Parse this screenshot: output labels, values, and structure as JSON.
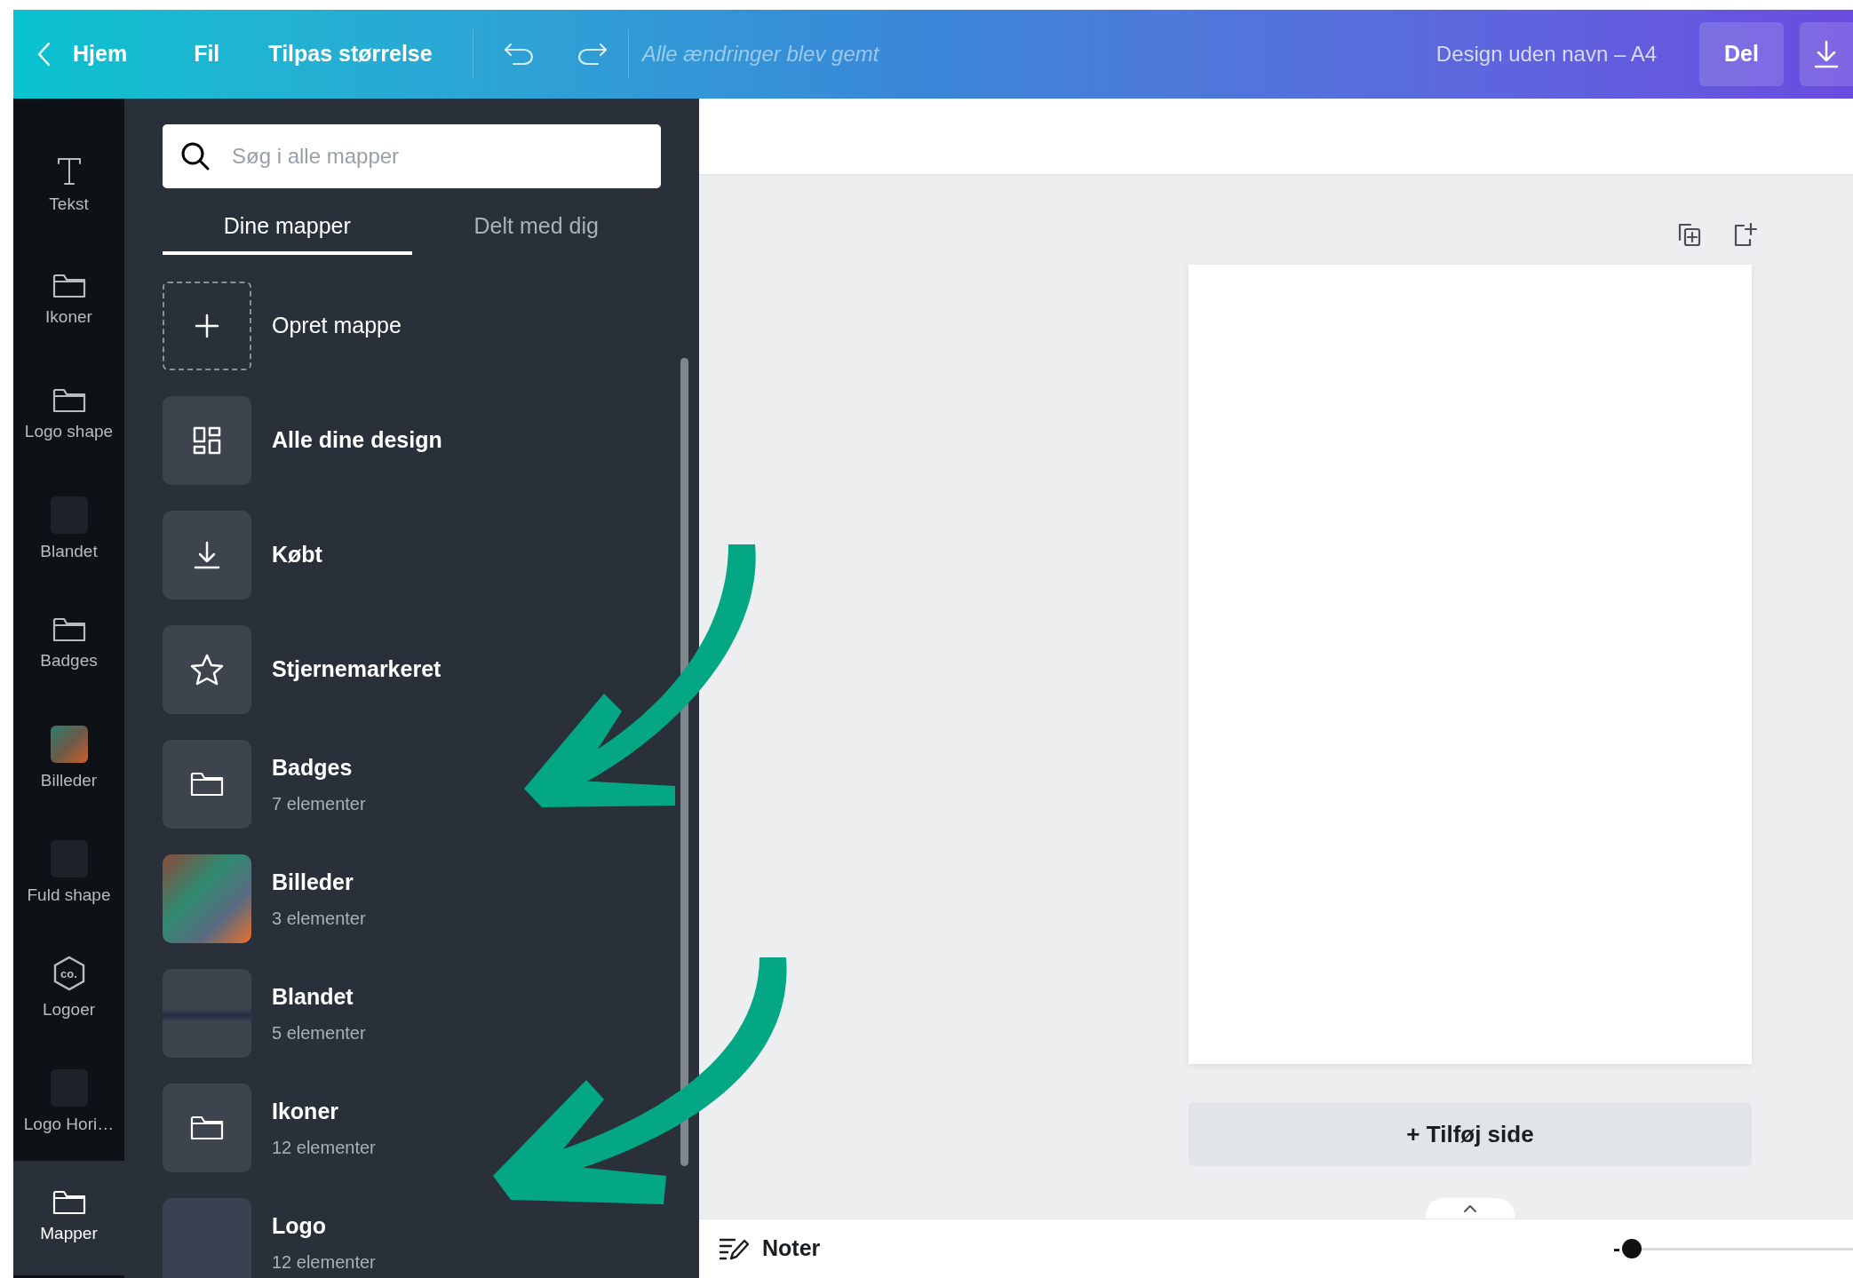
{
  "top_bar": {
    "back_label": "Hjem",
    "menu": [
      "Fil",
      "Tilpas størrelse"
    ],
    "save_status": "Alle ændringer blev gemt",
    "design_title": "Design uden navn – A4",
    "share_button": "Del"
  },
  "rail": [
    {
      "label": "Tekst",
      "kind": "text",
      "selected": false
    },
    {
      "label": "Ikoner",
      "kind": "folder",
      "selected": false
    },
    {
      "label": "Logo shape",
      "kind": "folder",
      "selected": false
    },
    {
      "label": "Blandet",
      "kind": "image",
      "selected": false
    },
    {
      "label": "Badges",
      "kind": "folder",
      "selected": false
    },
    {
      "label": "Billeder",
      "kind": "photo",
      "selected": false
    },
    {
      "label": "Fuld shape",
      "kind": "image",
      "selected": false
    },
    {
      "label": "Logoer",
      "kind": "logo",
      "icon_text": "co.",
      "selected": false
    },
    {
      "label": "Logo Hori…",
      "kind": "image",
      "selected": false
    },
    {
      "label": "Mapper",
      "kind": "folder",
      "selected": true
    }
  ],
  "panel": {
    "search": {
      "placeholder": "Søg i alle mapper"
    },
    "tabs": [
      {
        "label": "Dine mapper",
        "selected": true
      },
      {
        "label": "Delt med dig",
        "selected": false
      }
    ],
    "folders": [
      {
        "kind": "create",
        "title": "Opret mappe"
      },
      {
        "kind": "all",
        "title": "Alle dine design"
      },
      {
        "kind": "download",
        "title": "Købt"
      },
      {
        "kind": "star",
        "title": "Stjernemarkeret"
      },
      {
        "kind": "folder",
        "title": "Badges",
        "count": "7 elementer"
      },
      {
        "kind": "photo",
        "title": "Billeder",
        "count": "3 elementer"
      },
      {
        "kind": "mixed",
        "title": "Blandet",
        "count": "5 elementer"
      },
      {
        "kind": "folder",
        "title": "Ikoner",
        "count": "12 elementer"
      },
      {
        "kind": "image",
        "title": "Logo",
        "count": "12 elementer"
      }
    ]
  },
  "canvas": {
    "add_page": "+ Tilføj side"
  },
  "bottom_bar": {
    "notes": "Noter",
    "zoom": {
      "minus": "-",
      "level": 0
    }
  }
}
